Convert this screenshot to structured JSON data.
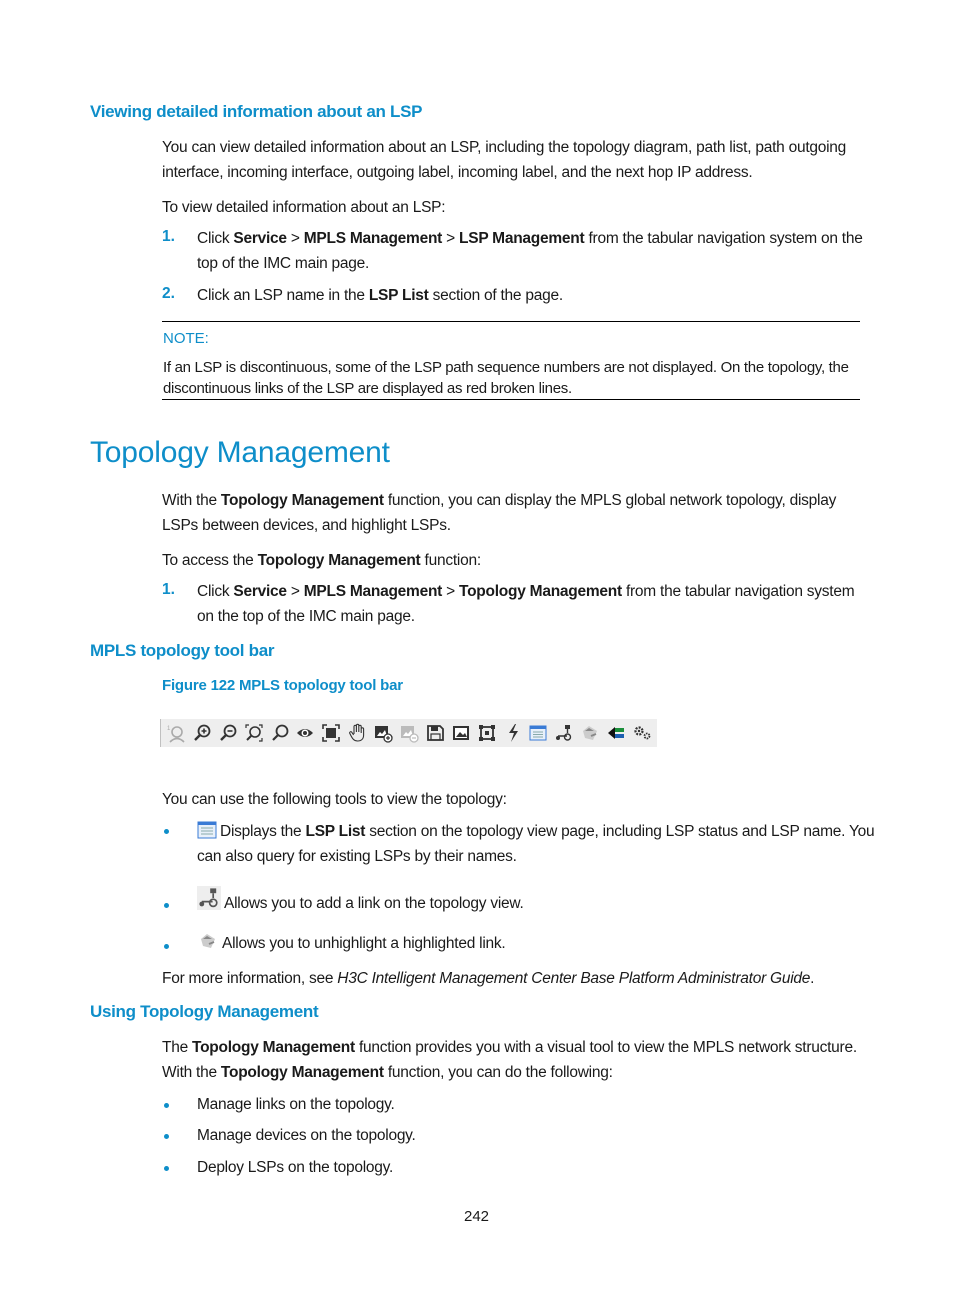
{
  "section1": {
    "heading": "Viewing detailed information about an LSP",
    "intro": "You can view detailed information about an LSP, including the topology diagram, path list, path outgoing interface, incoming interface, outgoing label, incoming label, and the next hop IP address.",
    "intro_line1": "You can view detailed information about an LSP, including the topology diagram, path list, path outgoing",
    "intro_line2": "interface, incoming interface, outgoing label, incoming label, and the next hop IP address.",
    "lead": "To view detailed information about an LSP:",
    "steps": [
      {
        "num": "1.",
        "t1": "Click ",
        "b1": "Service",
        "t2": " > ",
        "b2": "MPLS Management",
        "t3": " > ",
        "b3": "LSP Management",
        "t4": " from the tabular navigation system on the",
        "line2": "top of the IMC main page."
      },
      {
        "num": "2.",
        "t1": "Click an LSP name in the ",
        "b1": "LSP List",
        "t2": " section of the page."
      }
    ],
    "note": {
      "label": "NOTE:",
      "line1": "If an LSP is discontinuous, some of the LSP path sequence numbers are not displayed. On the topology, the",
      "line2": "discontinuous links of the LSP are displayed as red broken lines."
    }
  },
  "section2": {
    "heading": "Topology Management",
    "p1": {
      "t1": "With the ",
      "b1": "Topology Management",
      "t2": " function, you can display the MPLS global network topology, display",
      "line2": "LSPs between devices, and highlight LSPs."
    },
    "lead": {
      "t1": "To access the ",
      "b1": "Topology Management",
      "t2": " function:"
    },
    "steps": [
      {
        "num": "1.",
        "t1": "Click ",
        "b1": "Service",
        "t2": " > ",
        "b2": "MPLS Management",
        "t3": " > ",
        "b3": "Topology Management",
        "t4": " from the tabular navigation system",
        "line2": "on the top of the IMC main page."
      }
    ]
  },
  "section3": {
    "heading": "MPLS topology tool bar",
    "figure_caption": "Figure 122 MPLS topology tool bar",
    "toolbar_icons": [
      "select-zoom-icon",
      "zoom-in-icon",
      "zoom-out-icon",
      "fit-zoom-icon",
      "search-icon",
      "eye-icon",
      "fullscreen-icon",
      "hand-pan-icon",
      "add-image-icon",
      "remove-image-icon",
      "save-icon",
      "image-icon",
      "frame-icon",
      "lightning-icon",
      "lsp-list-icon",
      "add-link-icon",
      "unhighlight-icon",
      "highlight-arrow-icon",
      "settings-gears-icon"
    ],
    "lead": "You can use the following tools to view the topology:",
    "bullets": [
      {
        "icon": "lsp-list-icon",
        "t1": "Displays the ",
        "b1": "LSP List",
        "t2": " section on the topology view page, including LSP status and LSP name. You",
        "line2": "can also query for existing LSPs by their names."
      },
      {
        "icon": "add-link-icon",
        "text": "Allows you to add a link on the topology view."
      },
      {
        "icon": "unhighlight-icon",
        "text": "Allows you to unhighlight a highlighted link."
      }
    ],
    "more_info": {
      "t1": "For more information, see ",
      "i1": "H3C Intelligent Management Center Base Platform Administrator Guide",
      "t2": "."
    }
  },
  "section4": {
    "heading": "Using Topology Management",
    "p1": {
      "t1": "The ",
      "b1": "Topology Management",
      "t2": " function provides you with a visual tool to view the MPLS network structure."
    },
    "p2": {
      "t1": "With the ",
      "b1": "Topology Management",
      "t2": " function, you can do the following:"
    },
    "bullets": [
      "Manage links on the topology.",
      "Manage devices on the topology.",
      "Deploy LSPs on the topology."
    ]
  },
  "footer": {
    "page_number": "242"
  },
  "colors": {
    "accent": "#0e8ec9",
    "text": "#1a1a1a",
    "toolbar_bg": "#eeeeee"
  }
}
